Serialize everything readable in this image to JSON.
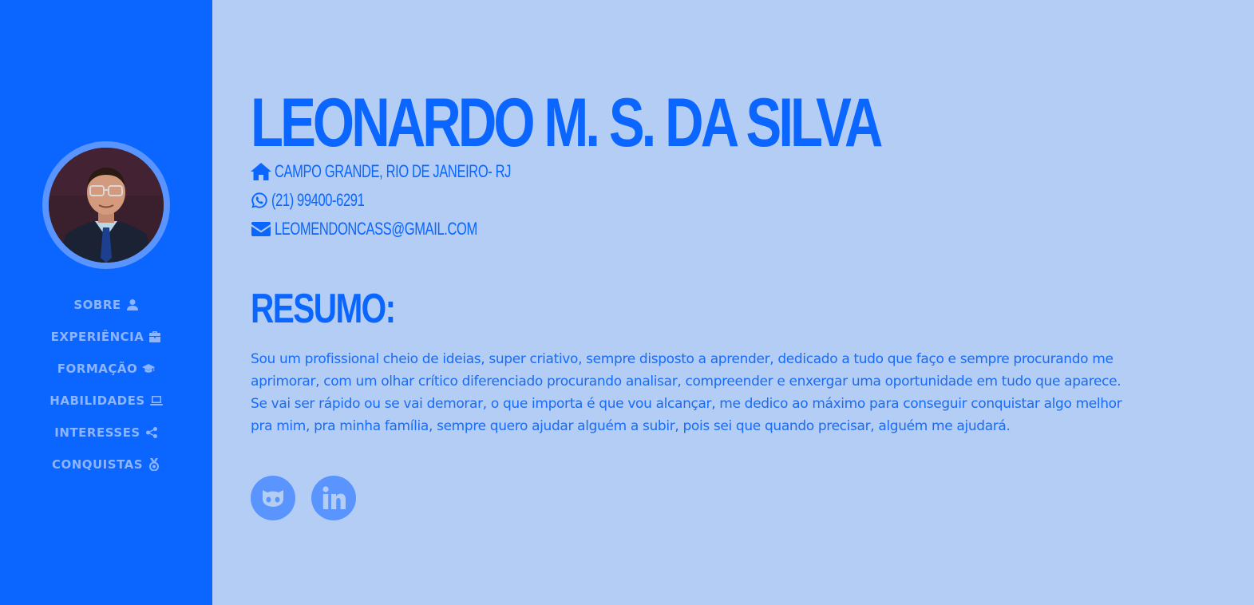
{
  "profile": {
    "name": "LEONARDO M. S. DA SILVA",
    "address": "CAMPO GRANDE, RIO DE JANEIRO- RJ",
    "phone": "(21) 99400-6291",
    "email": "LEOMENDONCASS@GMAIL.COM"
  },
  "sidebar": {
    "items": [
      {
        "label": "SOBRE",
        "icon": "user-icon"
      },
      {
        "label": "EXPERIÊNCIA",
        "icon": "briefcase-icon"
      },
      {
        "label": "FORMAÇÃO",
        "icon": "graduation-cap-icon"
      },
      {
        "label": "HABILIDADES",
        "icon": "laptop-icon"
      },
      {
        "label": "INTERESSES",
        "icon": "share-icon"
      },
      {
        "label": "CONQUISTAS",
        "icon": "medal-icon"
      }
    ]
  },
  "summary": {
    "title": "RESUMO:",
    "text": "Sou um profissional cheio de ideias, super criativo, sempre disposto a aprender, dedicado a tudo que faço e sempre procurando me aprimorar, com um olhar crítico diferenciado procurando analisar, compreender e enxergar uma oportunidade em tudo que aparece. Se vai ser rápido ou se vai demorar, o que importa é que vou alcançar, me dedico ao máximo para conseguir conquistar algo melhor pra mim, pra minha família, sempre quero ajudar alguém a subir, pois sei que quando precisar, alguém me ajudará."
  },
  "social": [
    {
      "icon": "github-icon"
    },
    {
      "icon": "linkedin-icon"
    }
  ],
  "colors": {
    "primary": "#0a66ff",
    "background": "#b3cdf5",
    "muted": "#8db4ff",
    "ring": "#5a95ff"
  }
}
